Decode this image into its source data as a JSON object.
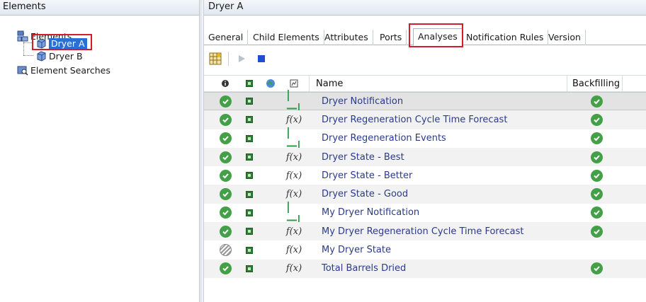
{
  "left_pane": {
    "title": "Elements",
    "tree": {
      "root_label": "Elements",
      "children": [
        {
          "label": "Dryer A",
          "selected": true
        },
        {
          "label": "Dryer B",
          "selected": false
        }
      ],
      "searches_label": "Element Searches"
    }
  },
  "right_pane": {
    "title": "Dryer A",
    "tabs": [
      {
        "label": "General"
      },
      {
        "label": "Child Elements"
      },
      {
        "label": "Attributes"
      },
      {
        "label": "Ports"
      },
      {
        "label": "Analyses",
        "active": true
      },
      {
        "label": "Notification Rules"
      },
      {
        "label": "Version"
      }
    ],
    "toolbar": {
      "buttons": [
        "new-analysis-icon",
        "start-icon",
        "stop-icon"
      ]
    },
    "grid": {
      "headers": {
        "name": "Name",
        "backfilling": "Backfilling"
      },
      "rows": [
        {
          "name": "Dryer Notification",
          "status": "ok",
          "type": "event",
          "backfill": true
        },
        {
          "name": "Dryer Regeneration Cycle Time Forecast",
          "status": "ok",
          "type": "expression",
          "backfill": true
        },
        {
          "name": "Dryer Regeneration Events",
          "status": "ok",
          "type": "event",
          "backfill": true
        },
        {
          "name": "Dryer State - Best",
          "status": "ok",
          "type": "expression",
          "backfill": true
        },
        {
          "name": "Dryer State - Better",
          "status": "ok",
          "type": "expression",
          "backfill": true
        },
        {
          "name": "Dryer State - Good",
          "status": "ok",
          "type": "expression",
          "backfill": true
        },
        {
          "name": "My Dryer Notification",
          "status": "ok",
          "type": "event",
          "backfill": true
        },
        {
          "name": "My Dryer Regeneration Cycle Time Forecast",
          "status": "ok",
          "type": "expression",
          "backfill": true
        },
        {
          "name": "My Dryer State",
          "status": "disabled",
          "type": "expression",
          "backfill": false
        },
        {
          "name": "Total Barrels Dried",
          "status": "ok",
          "type": "expression",
          "backfill": true
        }
      ]
    }
  },
  "colors": {
    "accent": "#2a6fd6",
    "highlight_box": "#d21d2b",
    "ok_green": "#43a047"
  }
}
